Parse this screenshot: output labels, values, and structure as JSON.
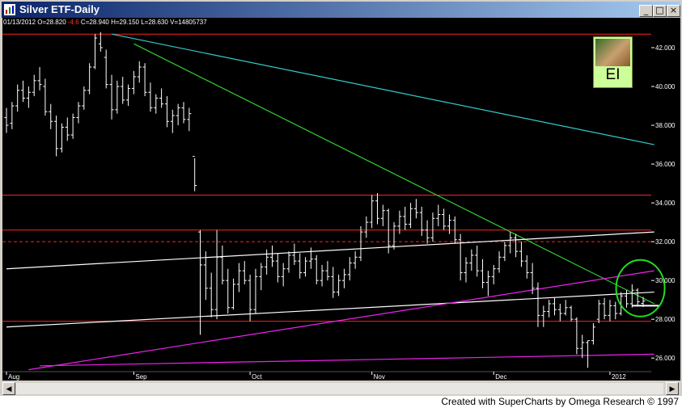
{
  "window": {
    "title": "Silver ETF-Daily",
    "buttons": {
      "minimize": "_",
      "maximize": "□",
      "close": "×"
    }
  },
  "info_line": {
    "date": "01/13/2012",
    "open": "O=28.820",
    "change": "-4.6",
    "close": "C=28.940",
    "high": "H=29.150",
    "low": "L=28.630",
    "volume": "V=14805737"
  },
  "badge": {
    "text": "EI"
  },
  "footer": "Created with SuperCharts by Omega Research © 1997",
  "colors": {
    "background": "#000000",
    "bars": "#ffffff",
    "horizontal_lines": "#ff2020",
    "cyan_trendline": "#33cccc",
    "green_trendline": "#33cc33",
    "magenta_trendline": "#ee22ee",
    "white_trendline": "#ffffff",
    "highlight_ellipse": "#22dd22"
  },
  "chart_data": {
    "type": "bar",
    "title": "Silver ETF-Daily",
    "y_ticks": [
      26,
      28,
      30,
      32,
      34,
      36,
      38,
      40,
      42
    ],
    "y_tick_labels": [
      "26.000",
      "28.000",
      "30.000",
      "32.000",
      "34.000",
      "36.000",
      "38.000",
      "40.000",
      "42.000"
    ],
    "ylim": [
      25.3,
      43.0
    ],
    "x_ticks": [
      {
        "label": "Aug",
        "index": 0
      },
      {
        "label": "Sep",
        "index": 23
      },
      {
        "label": "Oct",
        "index": 44
      },
      {
        "label": "Nov",
        "index": 66
      },
      {
        "label": "Dec",
        "index": 88
      },
      {
        "label": "2012",
        "index": 109
      }
    ],
    "ohlc": [
      {
        "o": 38.4,
        "h": 38.9,
        "l": 37.6,
        "c": 38.0
      },
      {
        "o": 38.1,
        "h": 39.2,
        "l": 37.8,
        "c": 39.0
      },
      {
        "o": 39.0,
        "h": 40.1,
        "l": 38.7,
        "c": 39.8
      },
      {
        "o": 39.8,
        "h": 40.3,
        "l": 39.2,
        "c": 39.4
      },
      {
        "o": 39.4,
        "h": 40.0,
        "l": 38.9,
        "c": 39.7
      },
      {
        "o": 39.7,
        "h": 40.6,
        "l": 39.5,
        "c": 40.3
      },
      {
        "o": 40.3,
        "h": 41.0,
        "l": 39.8,
        "c": 40.1
      },
      {
        "o": 40.0,
        "h": 40.4,
        "l": 38.5,
        "c": 38.7
      },
      {
        "o": 38.7,
        "h": 39.1,
        "l": 37.8,
        "c": 38.2
      },
      {
        "o": 38.2,
        "h": 38.5,
        "l": 36.4,
        "c": 36.8
      },
      {
        "o": 36.8,
        "h": 38.1,
        "l": 36.6,
        "c": 37.9
      },
      {
        "o": 37.9,
        "h": 38.4,
        "l": 37.2,
        "c": 37.5
      },
      {
        "o": 37.5,
        "h": 38.6,
        "l": 37.3,
        "c": 38.4
      },
      {
        "o": 38.4,
        "h": 39.2,
        "l": 38.1,
        "c": 39.0
      },
      {
        "o": 39.0,
        "h": 40.0,
        "l": 38.8,
        "c": 39.8
      },
      {
        "o": 39.8,
        "h": 41.2,
        "l": 39.6,
        "c": 41.0
      },
      {
        "o": 41.0,
        "h": 42.7,
        "l": 40.9,
        "c": 42.5
      },
      {
        "o": 42.2,
        "h": 42.8,
        "l": 41.8,
        "c": 42.0
      },
      {
        "o": 41.5,
        "h": 41.9,
        "l": 39.9,
        "c": 40.1
      },
      {
        "o": 40.1,
        "h": 40.6,
        "l": 38.3,
        "c": 38.8
      },
      {
        "o": 38.8,
        "h": 40.3,
        "l": 38.6,
        "c": 40.0
      },
      {
        "o": 40.0,
        "h": 40.5,
        "l": 39.1,
        "c": 39.3
      },
      {
        "o": 39.3,
        "h": 40.1,
        "l": 39.0,
        "c": 39.9
      },
      {
        "o": 39.9,
        "h": 40.8,
        "l": 39.6,
        "c": 40.5
      },
      {
        "o": 40.5,
        "h": 41.3,
        "l": 40.2,
        "c": 41.0
      },
      {
        "o": 41.0,
        "h": 41.2,
        "l": 39.5,
        "c": 39.7
      },
      {
        "o": 39.7,
        "h": 40.2,
        "l": 38.7,
        "c": 38.9
      },
      {
        "o": 38.9,
        "h": 39.6,
        "l": 38.6,
        "c": 39.4
      },
      {
        "o": 39.4,
        "h": 39.9,
        "l": 38.9,
        "c": 39.1
      },
      {
        "o": 39.1,
        "h": 39.5,
        "l": 37.9,
        "c": 38.2
      },
      {
        "o": 38.2,
        "h": 38.8,
        "l": 37.6,
        "c": 38.5
      },
      {
        "o": 38.5,
        "h": 39.1,
        "l": 38.0,
        "c": 38.9
      },
      {
        "o": 38.9,
        "h": 39.2,
        "l": 38.1,
        "c": 38.3
      },
      {
        "o": 38.3,
        "h": 38.9,
        "l": 37.7,
        "c": 38.6
      },
      {
        "o": 36.4,
        "h": 36.3,
        "l": 34.6,
        "c": 34.9
      },
      {
        "o": 32.5,
        "h": 32.6,
        "l": 27.2,
        "c": 30.8
      },
      {
        "o": 30.8,
        "h": 31.5,
        "l": 29.0,
        "c": 29.6
      },
      {
        "o": 29.6,
        "h": 30.4,
        "l": 28.1,
        "c": 28.5
      },
      {
        "o": 28.5,
        "h": 32.6,
        "l": 28.0,
        "c": 31.2
      },
      {
        "o": 31.2,
        "h": 31.8,
        "l": 29.8,
        "c": 30.0
      },
      {
        "o": 30.0,
        "h": 30.6,
        "l": 28.3,
        "c": 28.6
      },
      {
        "o": 28.6,
        "h": 30.1,
        "l": 28.5,
        "c": 29.8
      },
      {
        "o": 29.8,
        "h": 30.9,
        "l": 29.4,
        "c": 30.5
      },
      {
        "o": 30.5,
        "h": 31.0,
        "l": 29.8,
        "c": 30.0
      },
      {
        "o": 30.0,
        "h": 30.3,
        "l": 27.9,
        "c": 28.5
      },
      {
        "o": 28.5,
        "h": 30.6,
        "l": 28.3,
        "c": 30.2
      },
      {
        "o": 30.2,
        "h": 30.9,
        "l": 29.5,
        "c": 30.7
      },
      {
        "o": 30.7,
        "h": 31.6,
        "l": 30.3,
        "c": 31.2
      },
      {
        "o": 31.2,
        "h": 31.8,
        "l": 30.7,
        "c": 31.0
      },
      {
        "o": 31.0,
        "h": 31.4,
        "l": 29.9,
        "c": 30.2
      },
      {
        "o": 30.2,
        "h": 30.9,
        "l": 29.7,
        "c": 30.6
      },
      {
        "o": 30.6,
        "h": 31.5,
        "l": 30.4,
        "c": 31.3
      },
      {
        "o": 31.3,
        "h": 31.9,
        "l": 30.8,
        "c": 31.0
      },
      {
        "o": 31.0,
        "h": 31.4,
        "l": 30.1,
        "c": 30.4
      },
      {
        "o": 30.4,
        "h": 31.2,
        "l": 30.2,
        "c": 31.0
      },
      {
        "o": 31.0,
        "h": 31.7,
        "l": 30.6,
        "c": 31.1
      },
      {
        "o": 31.1,
        "h": 31.3,
        "l": 29.8,
        "c": 30.0
      },
      {
        "o": 30.0,
        "h": 30.8,
        "l": 29.7,
        "c": 30.5
      },
      {
        "o": 30.5,
        "h": 31.0,
        "l": 30.0,
        "c": 30.2
      },
      {
        "o": 30.2,
        "h": 30.7,
        "l": 29.1,
        "c": 29.4
      },
      {
        "o": 29.4,
        "h": 30.3,
        "l": 29.2,
        "c": 30.0
      },
      {
        "o": 30.0,
        "h": 30.6,
        "l": 29.6,
        "c": 30.3
      },
      {
        "o": 30.3,
        "h": 31.2,
        "l": 30.0,
        "c": 30.9
      },
      {
        "o": 30.9,
        "h": 31.5,
        "l": 30.6,
        "c": 31.2
      },
      {
        "o": 31.2,
        "h": 32.8,
        "l": 31.0,
        "c": 32.5
      },
      {
        "o": 32.5,
        "h": 33.3,
        "l": 32.2,
        "c": 33.0
      },
      {
        "o": 33.0,
        "h": 34.4,
        "l": 32.7,
        "c": 34.1
      },
      {
        "o": 34.1,
        "h": 34.5,
        "l": 32.9,
        "c": 33.2
      },
      {
        "o": 33.2,
        "h": 33.9,
        "l": 32.8,
        "c": 33.6
      },
      {
        "o": 33.6,
        "h": 33.7,
        "l": 31.4,
        "c": 31.8
      },
      {
        "o": 31.8,
        "h": 33.0,
        "l": 31.6,
        "c": 32.8
      },
      {
        "o": 32.8,
        "h": 33.6,
        "l": 32.4,
        "c": 33.3
      },
      {
        "o": 33.3,
        "h": 33.8,
        "l": 32.6,
        "c": 32.9
      },
      {
        "o": 32.9,
        "h": 34.0,
        "l": 32.7,
        "c": 33.7
      },
      {
        "o": 33.7,
        "h": 34.2,
        "l": 33.2,
        "c": 33.5
      },
      {
        "o": 33.5,
        "h": 33.8,
        "l": 32.3,
        "c": 32.6
      },
      {
        "o": 32.6,
        "h": 33.1,
        "l": 31.9,
        "c": 32.2
      },
      {
        "o": 32.2,
        "h": 33.5,
        "l": 32.0,
        "c": 33.2
      },
      {
        "o": 33.2,
        "h": 33.9,
        "l": 32.8,
        "c": 33.4
      },
      {
        "o": 33.4,
        "h": 33.7,
        "l": 32.6,
        "c": 32.8
      },
      {
        "o": 32.8,
        "h": 33.4,
        "l": 32.4,
        "c": 33.1
      },
      {
        "o": 33.1,
        "h": 33.3,
        "l": 31.9,
        "c": 32.1
      },
      {
        "o": 32.1,
        "h": 32.4,
        "l": 30.0,
        "c": 30.4
      },
      {
        "o": 30.4,
        "h": 31.2,
        "l": 29.9,
        "c": 30.9
      },
      {
        "o": 30.9,
        "h": 31.6,
        "l": 30.5,
        "c": 31.3
      },
      {
        "o": 31.3,
        "h": 31.8,
        "l": 30.2,
        "c": 30.5
      },
      {
        "o": 30.5,
        "h": 31.1,
        "l": 29.6,
        "c": 29.9
      },
      {
        "o": 29.9,
        "h": 30.5,
        "l": 29.2,
        "c": 30.2
      },
      {
        "o": 30.2,
        "h": 30.8,
        "l": 29.8,
        "c": 30.6
      },
      {
        "o": 30.6,
        "h": 31.5,
        "l": 30.4,
        "c": 31.2
      },
      {
        "o": 31.2,
        "h": 32.0,
        "l": 31.0,
        "c": 31.8
      },
      {
        "o": 31.8,
        "h": 32.5,
        "l": 31.4,
        "c": 32.2
      },
      {
        "o": 32.2,
        "h": 32.4,
        "l": 31.2,
        "c": 31.5
      },
      {
        "o": 31.5,
        "h": 32.0,
        "l": 30.7,
        "c": 31.0
      },
      {
        "o": 31.0,
        "h": 31.3,
        "l": 30.1,
        "c": 30.4
      },
      {
        "o": 30.4,
        "h": 30.9,
        "l": 29.3,
        "c": 29.6
      },
      {
        "o": 29.6,
        "h": 29.9,
        "l": 27.6,
        "c": 28.2
      },
      {
        "o": 28.2,
        "h": 28.7,
        "l": 27.6,
        "c": 28.4
      },
      {
        "o": 28.4,
        "h": 29.0,
        "l": 28.1,
        "c": 28.8
      },
      {
        "o": 28.8,
        "h": 29.1,
        "l": 28.2,
        "c": 28.5
      },
      {
        "o": 28.5,
        "h": 28.8,
        "l": 27.9,
        "c": 28.3
      },
      {
        "o": 28.3,
        "h": 29.0,
        "l": 28.2,
        "c": 28.6
      },
      {
        "o": 28.6,
        "h": 28.7,
        "l": 27.9,
        "c": 28.0
      },
      {
        "o": 28.0,
        "h": 28.1,
        "l": 26.2,
        "c": 26.5
      },
      {
        "o": 26.5,
        "h": 27.2,
        "l": 26.0,
        "c": 26.8
      },
      {
        "o": 26.8,
        "h": 26.9,
        "l": 25.5,
        "c": 26.9
      },
      {
        "o": 26.9,
        "h": 27.8,
        "l": 26.7,
        "c": 27.6
      },
      {
        "o": 28.0,
        "h": 29.0,
        "l": 27.8,
        "c": 28.8
      },
      {
        "o": 28.8,
        "h": 29.1,
        "l": 28.0,
        "c": 28.2
      },
      {
        "o": 28.2,
        "h": 29.0,
        "l": 27.9,
        "c": 28.7
      },
      {
        "o": 28.7,
        "h": 28.9,
        "l": 28.0,
        "c": 28.3
      },
      {
        "o": 28.3,
        "h": 29.4,
        "l": 28.2,
        "c": 29.2
      },
      {
        "o": 29.2,
        "h": 29.5,
        "l": 28.6,
        "c": 28.8
      },
      {
        "o": 28.8,
        "h": 29.8,
        "l": 28.6,
        "c": 29.5
      },
      {
        "o": 29.5,
        "h": 29.6,
        "l": 28.7,
        "c": 28.9
      },
      {
        "o": 28.82,
        "h": 29.15,
        "l": 28.63,
        "c": 28.94
      }
    ],
    "horizontal_lines": [
      {
        "price": 42.7,
        "color": "#ff2020",
        "style": "solid"
      },
      {
        "price": 34.4,
        "color": "#ff2020",
        "style": "solid"
      },
      {
        "price": 32.6,
        "color": "#ff2020",
        "style": "solid"
      },
      {
        "price": 32.0,
        "color": "#ff2020",
        "style": "dashed"
      },
      {
        "price": 27.9,
        "color": "#ff2020",
        "style": "solid"
      }
    ],
    "trendlines": [
      {
        "name": "cyan",
        "color": "#33cccc",
        "from": {
          "index": 19,
          "price": 42.7
        },
        "to": {
          "index": 117,
          "price": 37.0
        }
      },
      {
        "name": "green",
        "color": "#33cc33",
        "from": {
          "index": 23,
          "price": 42.2
        },
        "to": {
          "index": 117,
          "price": 28.8
        }
      },
      {
        "name": "white-upper",
        "color": "#ffffff",
        "from": {
          "index": 0,
          "price": 30.6
        },
        "to": {
          "index": 117,
          "price": 32.5
        }
      },
      {
        "name": "white-lower",
        "color": "#ffffff",
        "from": {
          "index": 0,
          "price": 27.6
        },
        "to": {
          "index": 117,
          "price": 29.4
        }
      },
      {
        "name": "magenta-upper",
        "color": "#ee22ee",
        "from": {
          "index": 4,
          "price": 25.4
        },
        "to": {
          "index": 117,
          "price": 30.5
        }
      },
      {
        "name": "magenta-lower",
        "color": "#ee22ee",
        "from": {
          "index": 6,
          "price": 25.6
        },
        "to": {
          "index": 117,
          "price": 26.2
        }
      }
    ],
    "support_marker": {
      "from_index": 113,
      "to_index": 117,
      "price": 28.7,
      "color": "#ffffff"
    },
    "highlight": {
      "index": 114.5,
      "price": 29.6,
      "color": "#22dd22"
    }
  }
}
